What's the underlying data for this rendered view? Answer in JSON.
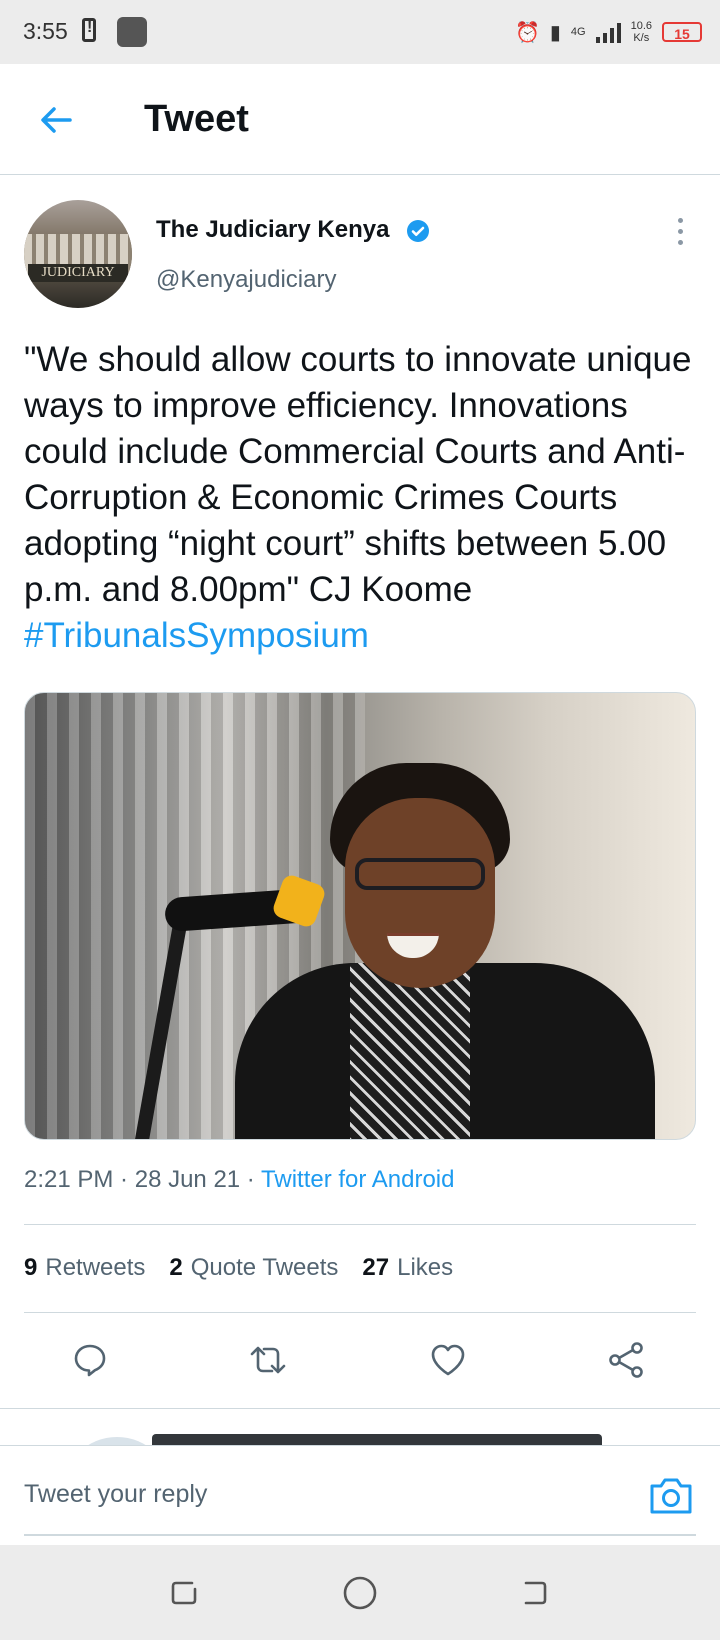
{
  "status_bar": {
    "time": "3:55",
    "network_label": "4G",
    "speed": "10.6",
    "speed_unit": "K/s",
    "battery": "15"
  },
  "header": {
    "title": "Tweet"
  },
  "tweet": {
    "author_name": "The Judiciary Kenya",
    "author_handle": "@Kenyajudiciary",
    "avatar_sign": "JUDICIARY",
    "text": "\"We should allow courts to innovate unique ways to improve efficiency. Innovations could include Commercial Courts and Anti-Corruption & Economic Crimes Courts adopting “night court” shifts between 5.00 p.m. and 8.00pm\" CJ Koome ",
    "hashtag": "#TribunalsSymposium",
    "time": "2:21 PM",
    "date": "28 Jun 21",
    "source": "Twitter for Android",
    "stats": {
      "retweets_count": "9",
      "retweets_label": "Retweets",
      "quotes_count": "2",
      "quotes_label": "Quote Tweets",
      "likes_count": "27",
      "likes_label": "Likes"
    }
  },
  "reply_bar": {
    "placeholder": "Tweet your reply"
  },
  "colors": {
    "accent": "#1d9bf0",
    "text_primary": "#0f1419",
    "text_secondary": "#536471",
    "divider": "#cfd9de",
    "battery_low": "#e53935"
  },
  "icons": [
    "back-arrow-icon",
    "verified-badge-icon",
    "more-vertical-icon",
    "reply-icon",
    "retweet-icon",
    "like-icon",
    "share-icon",
    "camera-icon",
    "recents-icon",
    "home-icon",
    "back-nav-icon"
  ]
}
